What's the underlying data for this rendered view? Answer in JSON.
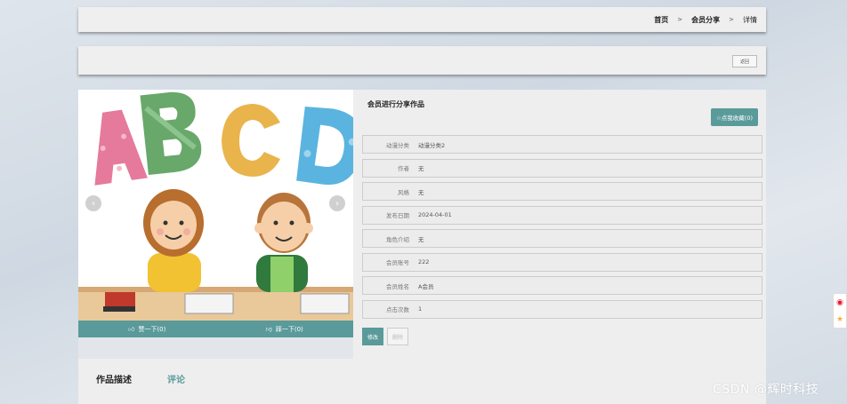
{
  "breadcrumb": {
    "home": "首页",
    "sep": ">",
    "section": "会员分享",
    "current": "详情"
  },
  "action_bar": {
    "back_label": "返回"
  },
  "carousel": {
    "prev_glyph": "‹",
    "next_glyph": "›"
  },
  "like_bar": {
    "like_label": "赞一下(0)",
    "dislike_label": "踩一下(0)",
    "like_icon": "thumbs-up-icon",
    "dislike_icon": "thumbs-down-icon"
  },
  "info": {
    "title": "会员进行分享作品",
    "fav_label": "☆点我收藏(0)",
    "rows": [
      {
        "key": "动漫分类",
        "value": "动漫分类2"
      },
      {
        "key": "作者",
        "value": "无"
      },
      {
        "key": "风格",
        "value": "无"
      },
      {
        "key": "发布日期",
        "value": "2024-04-01"
      },
      {
        "key": "角色介绍",
        "value": "无"
      },
      {
        "key": "会员账号",
        "value": "222"
      },
      {
        "key": "会员姓名",
        "value": "A会员"
      },
      {
        "key": "点击次数",
        "value": "1"
      }
    ],
    "edit_label": "修改",
    "delete_label": "删除"
  },
  "tabs": {
    "desc": "作品描述",
    "comment": "评论"
  },
  "watermark": "CSDN @辉时科技",
  "colors": {
    "accent": "#5a9a9a",
    "panel": "#efefef"
  }
}
